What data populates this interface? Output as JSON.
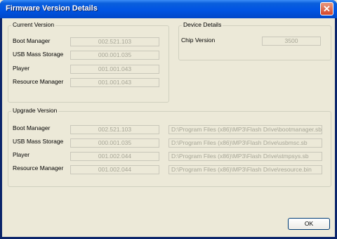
{
  "window": {
    "title": "Firmware Version Details",
    "close_glyph": "✕"
  },
  "current_version": {
    "legend": "Current Version",
    "rows": [
      {
        "label": "Boot Manager",
        "value": "002.521.103"
      },
      {
        "label": "USB Mass Storage",
        "value": "000.001.035"
      },
      {
        "label": "Player",
        "value": "001.001.043"
      },
      {
        "label": "Resource Manager",
        "value": "001.001.043"
      }
    ]
  },
  "device_details": {
    "legend": "Device Details",
    "chip_label": "Chip Version",
    "chip_value": "3500"
  },
  "upgrade_version": {
    "legend": "Upgrade Version",
    "rows": [
      {
        "label": "Boot Manager",
        "value": "002.521.103",
        "path": "D:\\Program Files (x86)\\MP3\\Flash Drive\\bootmanager.sb"
      },
      {
        "label": "USB Mass Storage",
        "value": "000.001.035",
        "path": "D:\\Program Files (x86)\\MP3\\Flash Drive\\usbmsc.sb"
      },
      {
        "label": "Player",
        "value": "001.002.044",
        "path": "D:\\Program Files (x86)\\MP3\\Flash Drive\\stmpsys.sb"
      },
      {
        "label": "Resource Manager",
        "value": "001.002.044",
        "path": "D:\\Program Files (x86)\\MP3\\Flash Drive\\resource.bin"
      }
    ]
  },
  "buttons": {
    "ok": "OK"
  }
}
